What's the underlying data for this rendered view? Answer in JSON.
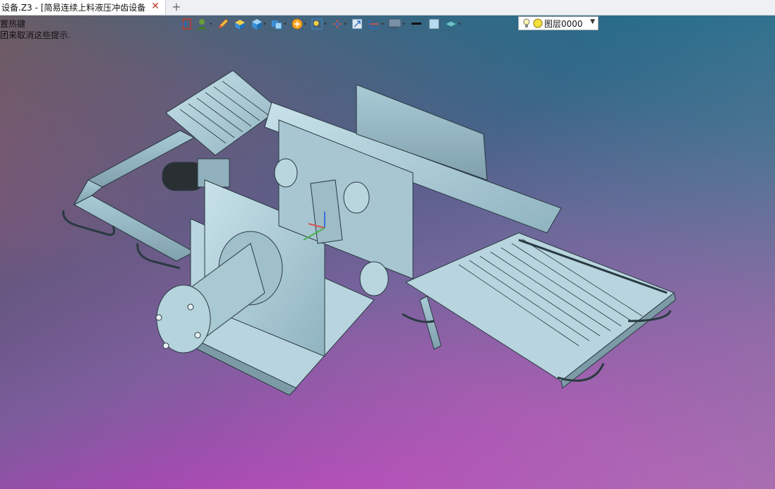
{
  "tab": {
    "title": "设备.Z3 - [简易连续上料液压冲齿设备]",
    "close": "✕",
    "add": "+"
  },
  "hints": [
    "置热键",
    "团来取消这些提示."
  ],
  "toolbar": {
    "icons": [
      "exit-icon",
      "user-icon",
      "pen-icon",
      "box-yellow-icon",
      "cube-icon",
      "view-cube-icon",
      "render-icon",
      "zoom-icon",
      "axis-icon",
      "fit-icon",
      "section-icon",
      "display-icon",
      "line-style-icon",
      "color-icon",
      "layer-stack-icon"
    ]
  },
  "layer": {
    "value": "图层0000"
  }
}
